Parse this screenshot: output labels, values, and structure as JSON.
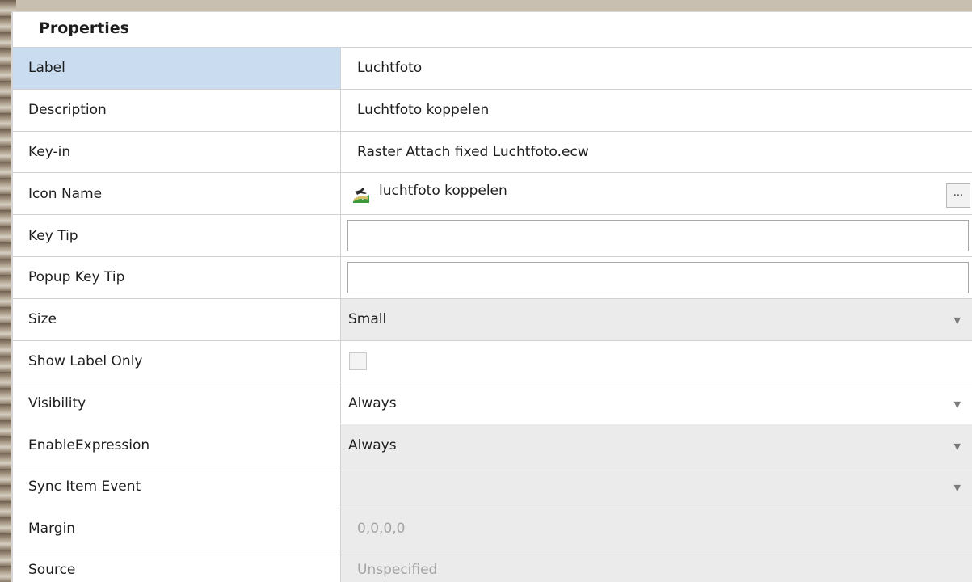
{
  "panel": {
    "title": "Properties"
  },
  "rows": [
    {
      "name": "Label",
      "value": "Luchtfoto"
    },
    {
      "name": "Description",
      "value": "Luchtfoto koppelen"
    },
    {
      "name": "Key-in",
      "value": "Raster Attach fixed Luchtfoto.ecw"
    },
    {
      "name": "Icon Name",
      "value": "luchtfoto koppelen",
      "button_label": "..."
    },
    {
      "name": "Key Tip",
      "value": ""
    },
    {
      "name": "Popup Key Tip",
      "value": ""
    },
    {
      "name": "Size",
      "value": "Small"
    },
    {
      "name": "Show Label Only",
      "checked": false
    },
    {
      "name": "Visibility",
      "value": "Always"
    },
    {
      "name": "EnableExpression",
      "value": "Always"
    },
    {
      "name": "Sync Item Event",
      "value": ""
    },
    {
      "name": "Margin",
      "value": "0,0,0,0"
    },
    {
      "name": "Source",
      "value": "Unspecified"
    }
  ],
  "icons": {
    "icon_name_preview": "aerial-photo-icon",
    "dropdown": "chevron-down-icon"
  },
  "colors": {
    "selected_row": "#cadcf0",
    "disabled_fill": "#ebebeb",
    "disabled_text": "#a4a4a4"
  }
}
